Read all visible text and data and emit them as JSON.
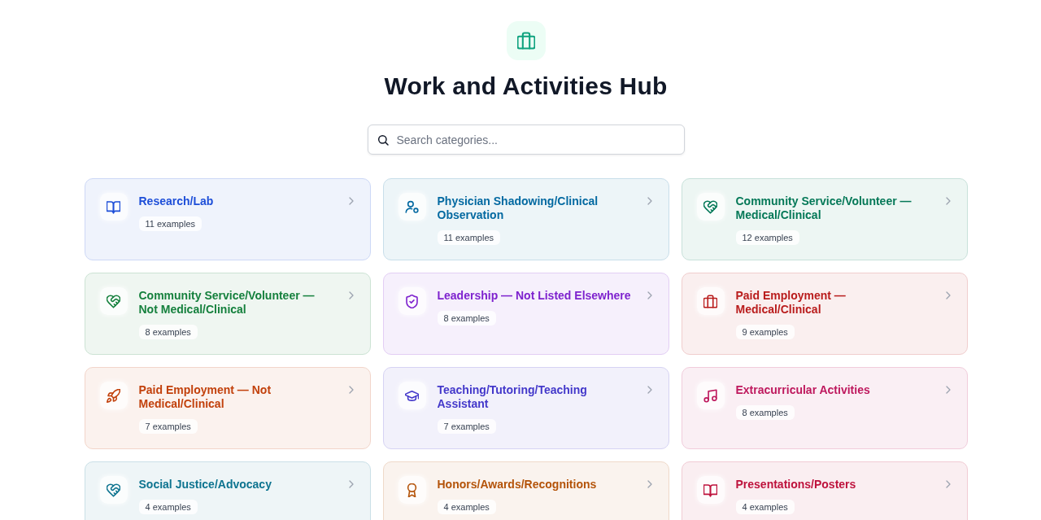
{
  "header": {
    "title": "Work and Activities Hub"
  },
  "search": {
    "placeholder": "Search categories..."
  },
  "categories": [
    {
      "title": "Research/Lab",
      "count": "11 examples",
      "kind": "book",
      "color": "#1d4ed8"
    },
    {
      "title": "Physician Shadowing/Clinical Observation",
      "count": "11 examples",
      "kind": "person",
      "color": "#0369a1"
    },
    {
      "title": "Community Service/Volunteer — Medical/Clinical",
      "count": "12 examples",
      "kind": "heart",
      "color": "#047857"
    },
    {
      "title": "Community Service/Volunteer — Not Medical/Clinical",
      "count": "8 examples",
      "kind": "heart",
      "color": "#15803d"
    },
    {
      "title": "Leadership — Not Listed Elsewhere",
      "count": "8 examples",
      "kind": "shield",
      "color": "#7e22ce"
    },
    {
      "title": "Paid Employment — Medical/Clinical",
      "count": "9 examples",
      "kind": "briefcase",
      "color": "#b91c1c"
    },
    {
      "title": "Paid Employment — Not Medical/Clinical",
      "count": "7 examples",
      "kind": "rocket",
      "color": "#c2410c"
    },
    {
      "title": "Teaching/Tutoring/Teaching Assistant",
      "count": "7 examples",
      "kind": "cap",
      "color": "#4338ca"
    },
    {
      "title": "Extracurricular Activities",
      "count": "8 examples",
      "kind": "music",
      "color": "#be185d"
    },
    {
      "title": "Social Justice/Advocacy",
      "count": "4 examples",
      "kind": "heart",
      "color": "#0e7490"
    },
    {
      "title": "Honors/Awards/Recognitions",
      "count": "4 examples",
      "kind": "award",
      "color": "#b45309"
    },
    {
      "title": "Presentations/Posters",
      "count": "4 examples",
      "kind": "book",
      "color": "#be123c"
    }
  ]
}
